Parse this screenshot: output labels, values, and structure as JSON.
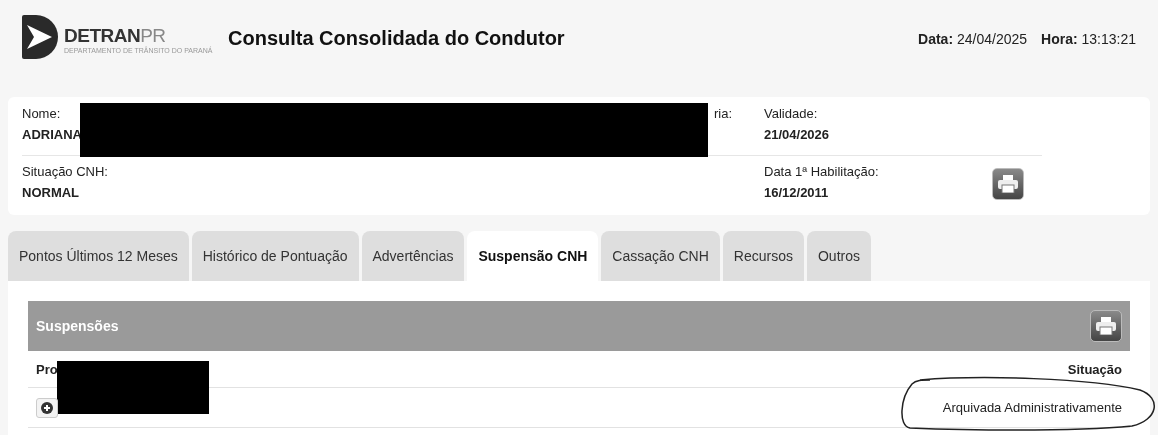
{
  "header": {
    "logo": {
      "name": "DETRAN",
      "suffix": "PR",
      "subtitle": "DEPARTAMENTO DE TRÂNSITO DO PARANÁ"
    },
    "title": "Consulta Consolidada do Condutor",
    "date_label": "Data:",
    "date": "24/04/2025",
    "time_label": "Hora:",
    "time": "13:13:21"
  },
  "driver": {
    "redacted": true,
    "rows": [
      {
        "cells": [
          {
            "label": "Nome:",
            "value": "ADRIANA"
          },
          {
            "label": "ria:"
          },
          {
            "label": "Validade:",
            "value": "21/04/2026"
          }
        ]
      },
      {
        "print": true,
        "cells": [
          {
            "label": "Situação CNH:",
            "value": "NORMAL"
          },
          "",
          {
            "label": "Data 1ª Habilitação:",
            "value": "16/12/2011"
          }
        ]
      }
    ]
  },
  "tabs": [
    {
      "label": "Pontos Últimos 12 Meses",
      "selected": false
    },
    {
      "label": "Histórico de Pontuação",
      "selected": false
    },
    {
      "label": "Advertências",
      "selected": false
    },
    {
      "label": "Suspensão CNH",
      "selected": true
    },
    {
      "label": "Cassação CNH",
      "selected": false
    },
    {
      "label": "Recursos",
      "selected": false
    },
    {
      "label": "Outros",
      "selected": false
    }
  ],
  "panel": {
    "title": "Suspensões",
    "print": true,
    "redacted": true,
    "columns": [
      "Pro",
      "Situação"
    ],
    "rows": [
      {
        "situacao": "Arquivada Administrativamente",
        "circled": true
      }
    ]
  }
}
